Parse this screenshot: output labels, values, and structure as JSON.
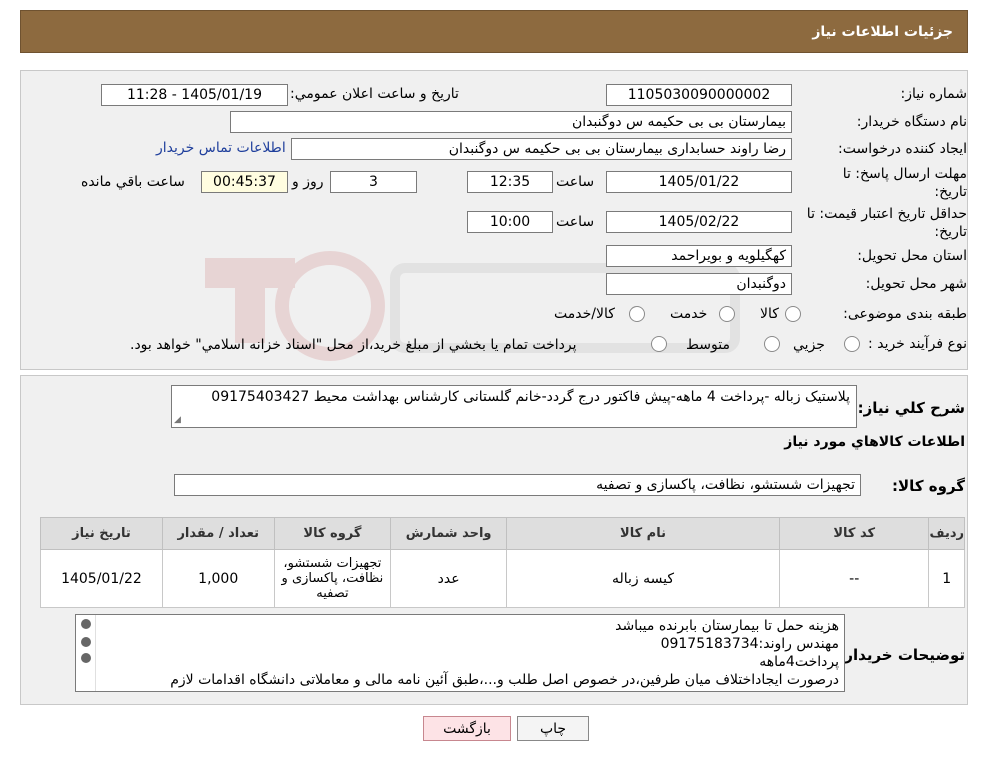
{
  "header": {
    "title": "جزئیات اطلاعات نیاز"
  },
  "fields": {
    "need_number_label": "شماره نیاز:",
    "need_number": "1105030090000002",
    "announce_label": "تاریخ و ساعت اعلان عمومي:",
    "announce_value": "1405/01/19 - 11:28",
    "buyer_org_label": "نام دستگاه خريدار:",
    "buyer_org": "بیمارستان بی بی حکیمه س  دوگنبدان",
    "requester_label": "ايجاد کننده درخواست:",
    "requester": "رضا راوند حسابداری بیمارستان بی بی حکیمه س  دوگنبدان",
    "contact_link": "اطلاعات تماس خريدار",
    "deadline_label_1": "مهلت ارسال پاسخ: تا",
    "deadline_label_2": "تاريخ:",
    "deadline_date": "1405/01/22",
    "time_label": "ساعت",
    "deadline_time": "12:35",
    "days_value": "3",
    "days_label": "روز و",
    "remaining_time": "00:45:37",
    "remaining_label": "ساعت باقي مانده",
    "validity_label_1": "حداقل تاريخ اعتبار قيمت: تا",
    "validity_label_2": "تاريخ:",
    "validity_date": "1405/02/22",
    "validity_time": "10:00",
    "province_label": "استان محل تحويل:",
    "province": "کهگیلویه و بویراحمد",
    "city_label": "شهر محل تحويل:",
    "city": "دوگنبدان",
    "category_label": "طبقه بندی موضوعی:",
    "category_options": [
      "کالا",
      "خدمت",
      "کالا/خدمت"
    ],
    "process_label": "نوع فرآيند خريد :",
    "process_options": [
      "جزيي",
      "متوسط"
    ],
    "process_note": "پرداخت تمام يا بخشي از مبلغ خريد،از محل \"اسناد خزانه اسلامي\" خواهد بود."
  },
  "description": {
    "label": "شرح كلي نياز:",
    "text": "پلاستیک زباله -پرداخت 4 ماهه-پیش فاکتور درج گردد-خانم گلستانی کارشناس بهداشت محیط 09175403427"
  },
  "goods": {
    "section_title": "اطلاعات كالاهاي مورد نياز",
    "group_label": "گروه کالا:",
    "group_value": "تجهیزات شستشو، نظافت، پاکسازی و تصفیه",
    "columns": [
      "رديف",
      "کد کالا",
      "نام کالا",
      "واحد شمارش",
      "گروه کالا",
      "تعداد / مقدار",
      "تاریخ نیاز"
    ],
    "rows": [
      {
        "index": "1",
        "code": "--",
        "name": "کیسه زباله",
        "unit": "عدد",
        "group_lines": [
          "تجهیزات شستشو،",
          "نظافت، پاکسازی و",
          "تصفیه"
        ],
        "qty": "1,000",
        "date": "1405/01/22"
      }
    ]
  },
  "notes": {
    "label": "توضيحات خريدار:",
    "lines": [
      "هزینه حمل تا بیمارستان بابرنده میباشد",
      "مهندس راوند:09175183734",
      "پرداخت4ماهه",
      "درصورت ایجاداختلاف میان طرفین،در خصوص اصل طلب و...،طبق آئین نامه مالی و معاملاتی دانشگاه اقدامات لازم"
    ]
  },
  "buttons": {
    "print": "چاپ",
    "back": "بازگشت"
  }
}
